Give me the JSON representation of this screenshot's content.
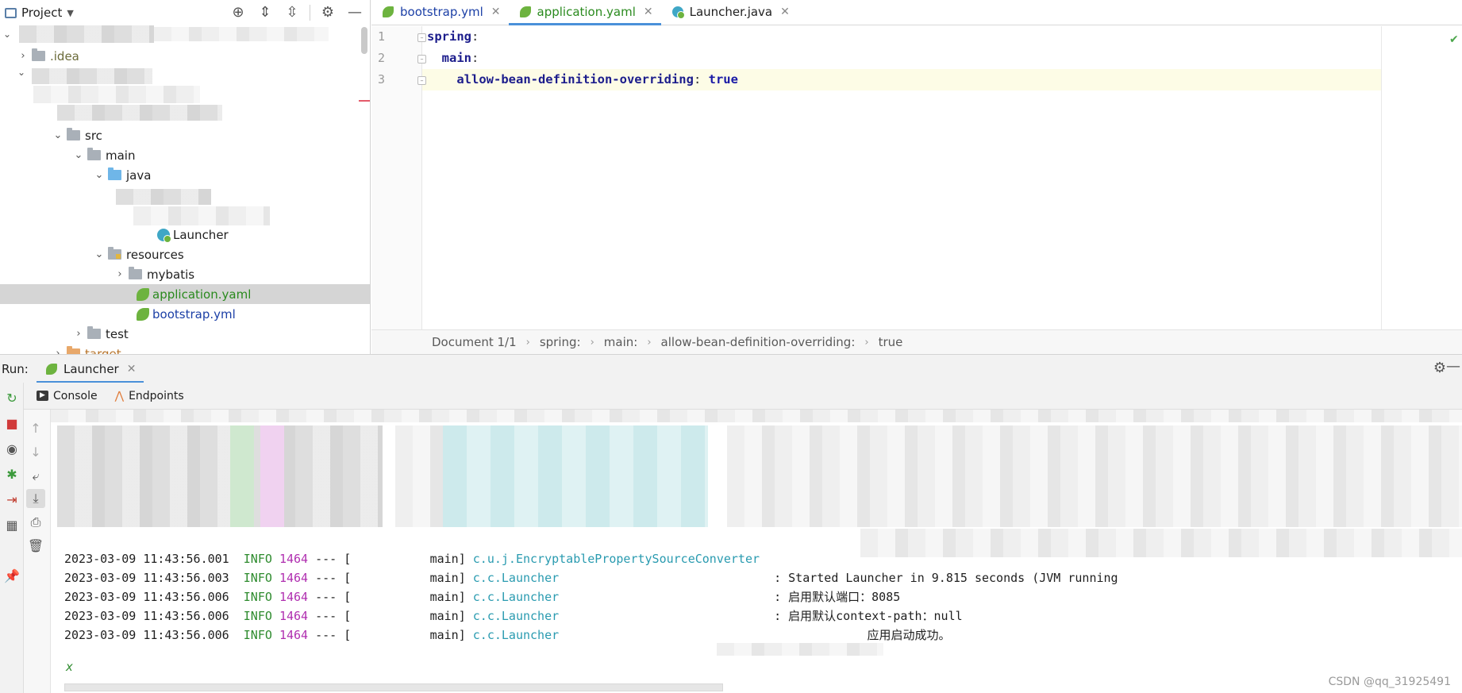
{
  "project": {
    "title": "Project",
    "tree": [
      {
        "label": ".idea",
        "kind": "folder"
      },
      {
        "label": "src",
        "kind": "folder"
      },
      {
        "label": "main",
        "kind": "folder"
      },
      {
        "label": "java",
        "kind": "folder-blue"
      },
      {
        "label": "Launcher",
        "kind": "java"
      },
      {
        "label": "resources",
        "kind": "folder-res"
      },
      {
        "label": "mybatis",
        "kind": "folder"
      },
      {
        "label": "application.yaml",
        "kind": "spring"
      },
      {
        "label": "bootstrap.yml",
        "kind": "spring"
      },
      {
        "label": "test",
        "kind": "folder"
      },
      {
        "label": "target",
        "kind": "folder-orange"
      }
    ]
  },
  "editor": {
    "tabs": [
      {
        "label": "bootstrap.yml"
      },
      {
        "label": "application.yaml"
      },
      {
        "label": "Launcher.java"
      }
    ],
    "line_numbers": [
      "1",
      "2",
      "3"
    ],
    "code": {
      "l1_key": "spring",
      "l2_key": "main",
      "l3_key": "allow-bean-definition-overriding",
      "l3_value": "true",
      "colon": ":"
    },
    "breadcrumb": [
      "Document 1/1",
      "spring:",
      "main:",
      "allow-bean-definition-overriding:",
      "true"
    ]
  },
  "run": {
    "label": "Run:",
    "tab": "Launcher",
    "subtabs": {
      "console": "Console",
      "endpoints": "Endpoints"
    },
    "logs": [
      {
        "ts": "2023-03-09 11:43:56.001",
        "level": "INFO",
        "pid": "1464",
        "sep": "---",
        "thread": "[           main]",
        "cls": "c.u.j.EncryptablePropertySourceConverter",
        "msg": ""
      },
      {
        "ts": "2023-03-09 11:43:56.003",
        "level": "INFO",
        "pid": "1464",
        "sep": "---",
        "thread": "[           main]",
        "cls": "c.c.Launcher",
        "msg": ": Started Launcher in 9.815 seconds (JVM running"
      },
      {
        "ts": "2023-03-09 11:43:56.006",
        "level": "INFO",
        "pid": "1464",
        "sep": "---",
        "thread": "[           main]",
        "cls": "c.c.Launcher",
        "msg": ": 启用默认端口：8085"
      },
      {
        "ts": "2023-03-09 11:43:56.006",
        "level": "INFO",
        "pid": "1464",
        "sep": "---",
        "thread": "[           main]",
        "cls": "c.c.Launcher",
        "msg": ": 启用默认context-path：null"
      },
      {
        "ts": "2023-03-09 11:43:56.006",
        "level": "INFO",
        "pid": "1464",
        "sep": "---",
        "thread": "[           main]",
        "cls": "c.c.Launcher",
        "msg": "应用启动成功。"
      }
    ],
    "prompt": "x"
  },
  "watermark": "CSDN @qq_31925491",
  "colors": {
    "accent": "#4a90d9",
    "spring_green": "#6db33f",
    "selection": "#d5d5d5"
  }
}
